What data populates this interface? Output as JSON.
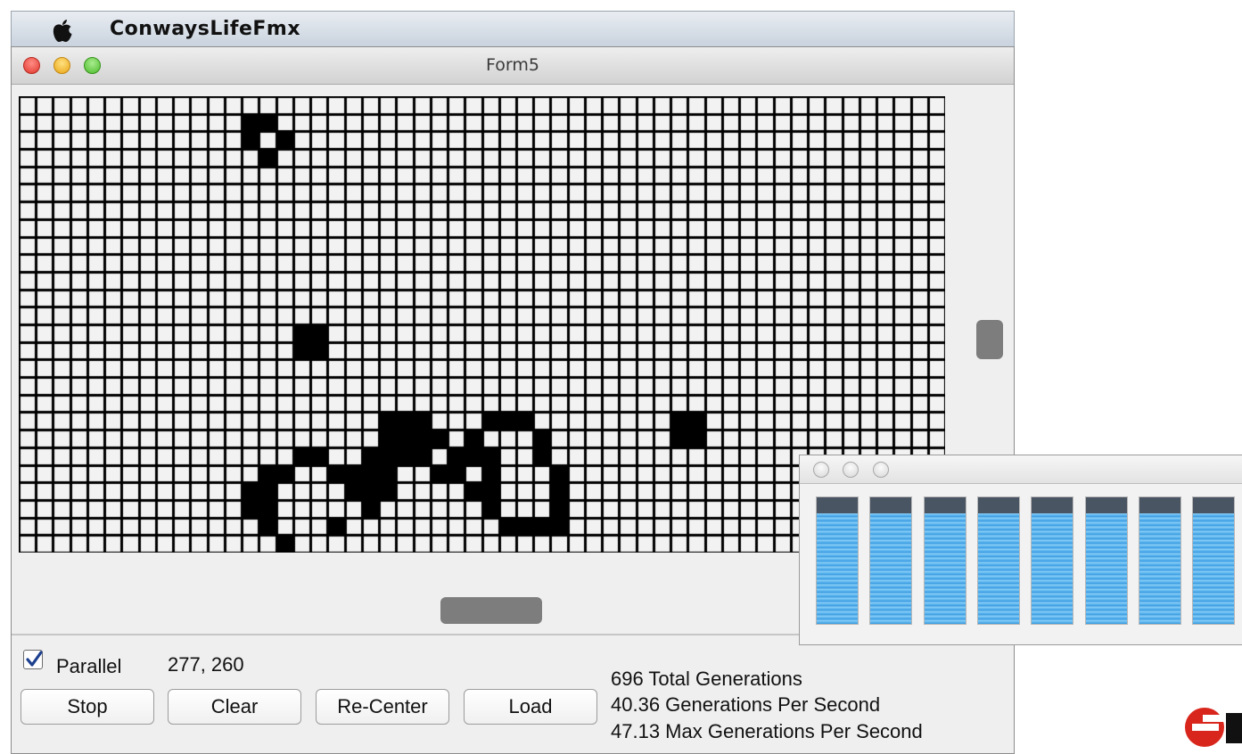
{
  "menubar": {
    "app_name": "ConwaysLifeFmx"
  },
  "window": {
    "title": "Form5"
  },
  "grid": {
    "columns": 54,
    "rows": 26,
    "alive_cells": [
      [
        13,
        1
      ],
      [
        14,
        1
      ],
      [
        13,
        2
      ],
      [
        15,
        2
      ],
      [
        14,
        3
      ],
      [
        16,
        13
      ],
      [
        17,
        13
      ],
      [
        16,
        14
      ],
      [
        17,
        14
      ],
      [
        21,
        18
      ],
      [
        22,
        18
      ],
      [
        23,
        18
      ],
      [
        27,
        18
      ],
      [
        28,
        18
      ],
      [
        29,
        18
      ],
      [
        38,
        18
      ],
      [
        39,
        18
      ],
      [
        21,
        19
      ],
      [
        22,
        19
      ],
      [
        23,
        19
      ],
      [
        24,
        19
      ],
      [
        26,
        19
      ],
      [
        30,
        19
      ],
      [
        38,
        19
      ],
      [
        39,
        19
      ],
      [
        16,
        20
      ],
      [
        17,
        20
      ],
      [
        20,
        20
      ],
      [
        21,
        20
      ],
      [
        22,
        20
      ],
      [
        23,
        20
      ],
      [
        25,
        20
      ],
      [
        26,
        20
      ],
      [
        27,
        20
      ],
      [
        30,
        20
      ],
      [
        14,
        21
      ],
      [
        15,
        21
      ],
      [
        18,
        21
      ],
      [
        19,
        21
      ],
      [
        20,
        21
      ],
      [
        21,
        21
      ],
      [
        24,
        21
      ],
      [
        25,
        21
      ],
      [
        27,
        21
      ],
      [
        31,
        21
      ],
      [
        13,
        22
      ],
      [
        14,
        22
      ],
      [
        19,
        22
      ],
      [
        20,
        22
      ],
      [
        21,
        22
      ],
      [
        26,
        22
      ],
      [
        27,
        22
      ],
      [
        31,
        22
      ],
      [
        13,
        23
      ],
      [
        14,
        23
      ],
      [
        20,
        23
      ],
      [
        27,
        23
      ],
      [
        31,
        23
      ],
      [
        14,
        24
      ],
      [
        18,
        24
      ],
      [
        28,
        24
      ],
      [
        29,
        24
      ],
      [
        30,
        24
      ],
      [
        31,
        24
      ],
      [
        15,
        25
      ]
    ]
  },
  "controls": {
    "parallel_label": "Parallel",
    "parallel_checked": true,
    "coords": "277, 260",
    "buttons": {
      "stop": "Stop",
      "clear": "Clear",
      "recenter": "Re-Center",
      "load": "Load"
    }
  },
  "stats": {
    "total": "696 Total Generations",
    "per_second": "40.36 Generations Per Second",
    "max_per_second": "47.13 Max Generations Per Second"
  },
  "cpu_monitor": {
    "bars": [
      0.87,
      0.87,
      0.87,
      0.87,
      0.87,
      0.87,
      0.87,
      0.87
    ]
  },
  "colors": {
    "cell_alive": "#000000",
    "cell_dead": "#f2f2f2",
    "cpu_fill": "#5cb5ee",
    "checkbox_check": "#1c3f8f",
    "logo_red": "#d9261c"
  },
  "icons": {
    "menubar": "apple-icon",
    "checkbox": "checkmark-icon",
    "logo": "e-logo-icon"
  }
}
